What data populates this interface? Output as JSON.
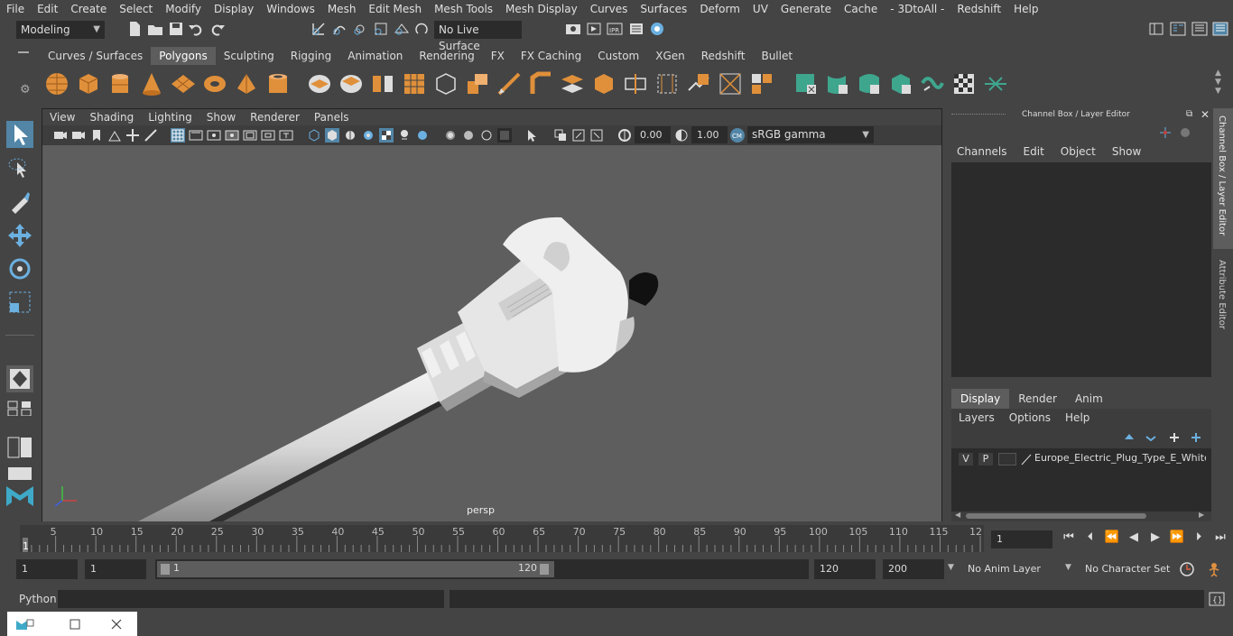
{
  "menubar": [
    "File",
    "Edit",
    "Create",
    "Select",
    "Modify",
    "Display",
    "Windows",
    "Mesh",
    "Edit Mesh",
    "Mesh Tools",
    "Mesh Display",
    "Curves",
    "Surfaces",
    "Deform",
    "UV",
    "Generate",
    "Cache",
    "- 3DtoAll -",
    "Redshift",
    "Help"
  ],
  "status": {
    "mode": "Modeling",
    "live_surface": "No Live Surface"
  },
  "shelf_tabs": [
    "Curves / Surfaces",
    "Polygons",
    "Sculpting",
    "Rigging",
    "Animation",
    "Rendering",
    "FX",
    "FX Caching",
    "Custom",
    "XGen",
    "Redshift",
    "Bullet"
  ],
  "shelf_active": "Polygons",
  "viewport": {
    "menu": [
      "View",
      "Shading",
      "Lighting",
      "Show",
      "Renderer",
      "Panels"
    ],
    "exposure": "0.00",
    "gamma": "1.00",
    "color_space": "sRGB gamma",
    "camera_label": "persp"
  },
  "channel_box": {
    "title": "Channel Box / Layer Editor",
    "menu": [
      "Channels",
      "Edit",
      "Object",
      "Show"
    ],
    "layer_tabs": [
      "Display",
      "Render",
      "Anim"
    ],
    "active_layer_tab": "Display",
    "layer_menu": [
      "Layers",
      "Options",
      "Help"
    ],
    "layer": {
      "v": "V",
      "p": "P",
      "name": "Europe_Electric_Plug_Type_E_White_("
    }
  },
  "side_tabs": {
    "channel": "Channel Box / Layer Editor",
    "attribute": "Attribute Editor"
  },
  "timeline": {
    "ticks": [
      "5",
      "10",
      "15",
      "20",
      "25",
      "30",
      "35",
      "40",
      "45",
      "50",
      "55",
      "60",
      "65",
      "70",
      "75",
      "80",
      "85",
      "90",
      "95",
      "100",
      "105",
      "110",
      "115",
      "12"
    ],
    "start_marker": "1",
    "current_frame": "1"
  },
  "range": {
    "start": "1",
    "playback_start": "1",
    "slider_start": "1",
    "slider_end": "120",
    "playback_end": "120",
    "end": "200",
    "anim_layer": "No Anim Layer",
    "char_set": "No Character Set"
  },
  "command": {
    "label": "Python"
  },
  "colors": {
    "accent_blue": "#5285a6",
    "polygon_orange": "#e0903a",
    "teal": "#3fa68e"
  }
}
